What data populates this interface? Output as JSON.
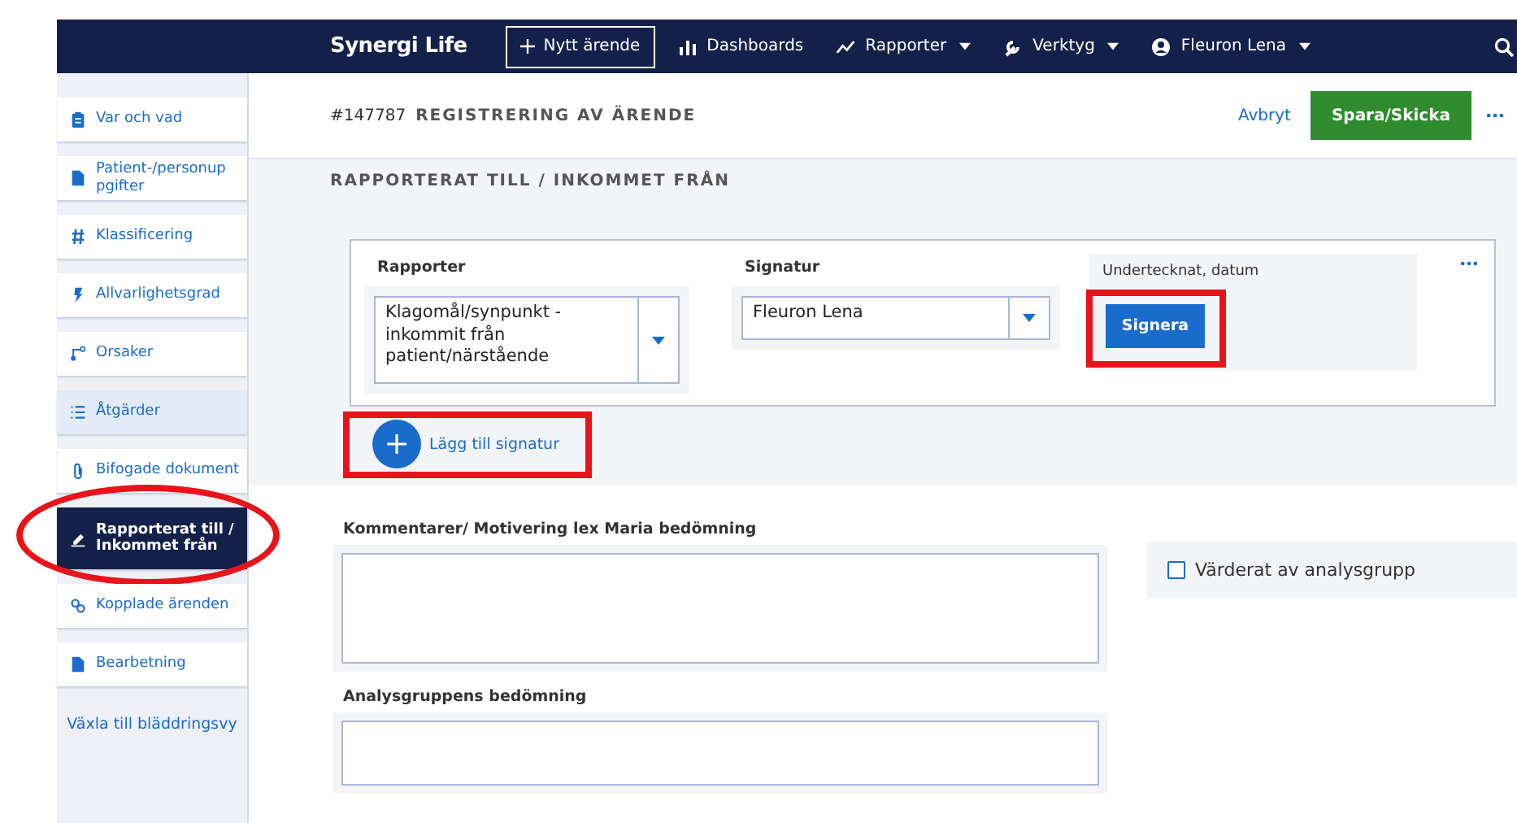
{
  "navbar": {
    "brand": "Synergi Life",
    "new_button": "Nytt ärende",
    "items": [
      {
        "label": "Dashboards",
        "dropdown": false
      },
      {
        "label": "Rapporter",
        "dropdown": true
      },
      {
        "label": "Verktyg",
        "dropdown": true
      },
      {
        "label": "Fleuron Lena",
        "dropdown": true
      }
    ]
  },
  "sidebar": {
    "items": [
      {
        "label": "Var och vad",
        "selected": false,
        "hovered": false,
        "circled": false
      },
      {
        "label": "Patient-/personup pgifter",
        "selected": false,
        "hovered": false,
        "circled": false
      },
      {
        "label": "Klassificering",
        "selected": false,
        "hovered": false,
        "circled": false
      },
      {
        "label": "Allvarlighetsgrad",
        "selected": false,
        "hovered": false,
        "circled": false
      },
      {
        "label": "Orsaker",
        "selected": false,
        "hovered": false,
        "circled": false
      },
      {
        "label": "Åtgärder",
        "selected": false,
        "hovered": true,
        "circled": false
      },
      {
        "label": "Bifogade dokument",
        "selected": false,
        "hovered": false,
        "circled": false
      },
      {
        "label": "Rapporterat till / Inkommet från",
        "selected": true,
        "hovered": false,
        "circled": true
      },
      {
        "label": "Kopplade ärenden",
        "selected": false,
        "hovered": false,
        "circled": false
      },
      {
        "label": "Bearbetning",
        "selected": false,
        "hovered": false,
        "circled": false
      }
    ],
    "toggle_link": "Växla till bläddringsvy"
  },
  "header": {
    "case_number": "#147787",
    "title": "REGISTRERING AV ÄRENDE",
    "cancel": "Avbryt",
    "save": "Spara/Skicka"
  },
  "section": {
    "title": "RAPPORTERAT TILL / INKOMMET FRÅN",
    "signature_card": {
      "reporter_label": "Rapporter",
      "reporter_value": "Klagomål/synpunkt - inkommit från patient/närstående",
      "signature_label": "Signatur",
      "signature_value": "Fleuron Lena",
      "signed_label": "Undertecknat, datum",
      "sign_button": "Signera",
      "sign_marked": true
    },
    "add_signature": "Lägg till signatur",
    "add_marked": true
  },
  "comments": {
    "label": "Kommentarer/ Motivering lex Maria bedömning"
  },
  "evaluated": {
    "label": "Värderat av analysgrupp",
    "checked": false
  },
  "analysis": {
    "label": "Analysgruppens bedömning"
  }
}
